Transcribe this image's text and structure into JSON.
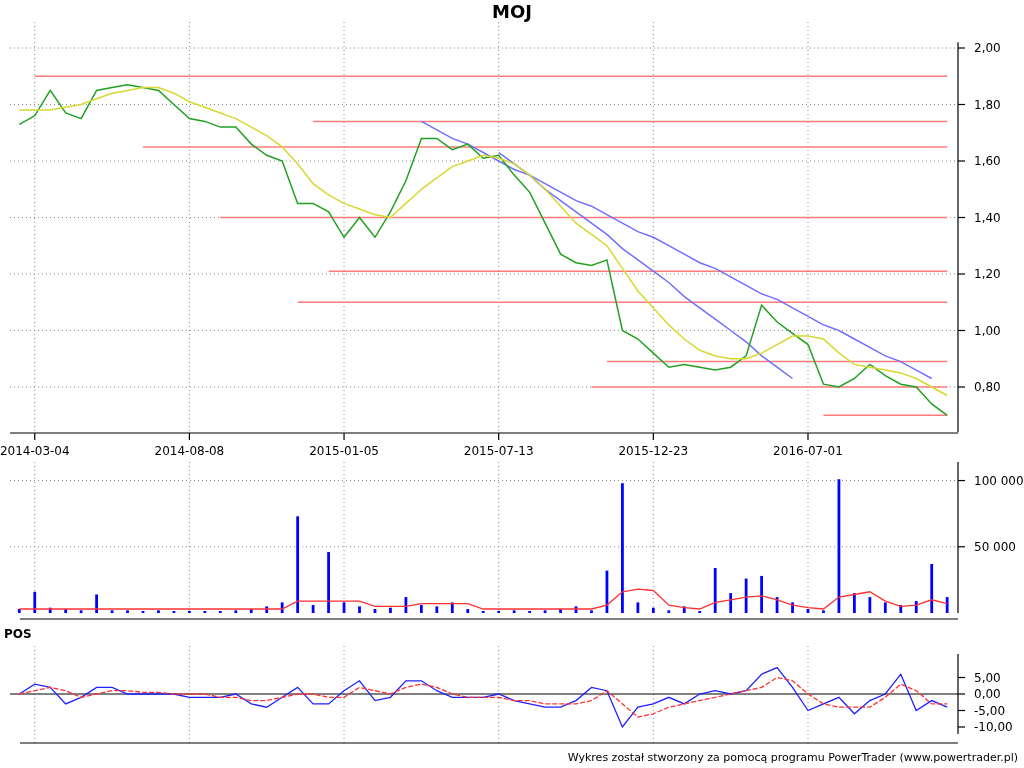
{
  "title": "MOJ",
  "price_panel": {
    "chart_data": {
      "type": "line",
      "categories": [
        null,
        "2014-03-04",
        null,
        null,
        null,
        null,
        null,
        null,
        null,
        null,
        null,
        "2014-08-08",
        null,
        null,
        null,
        null,
        null,
        null,
        null,
        null,
        null,
        "2015-01-05",
        null,
        null,
        null,
        null,
        null,
        null,
        null,
        null,
        null,
        "2015-07-13",
        null,
        null,
        null,
        null,
        null,
        null,
        null,
        null,
        null,
        "2015-12-23",
        null,
        null,
        null,
        null,
        null,
        null,
        null,
        null,
        null,
        "2016-07-01",
        null,
        null,
        null,
        null,
        null,
        null,
        null,
        null,
        null
      ],
      "series": [
        {
          "color": "#ff7b7b",
          "values": [
            null,
            1.9,
            1.9,
            1.9,
            1.9,
            1.9,
            1.9,
            1.9,
            1.9,
            1.9,
            1.9,
            1.9,
            1.9,
            1.9,
            1.9,
            1.9,
            1.9,
            1.9,
            1.9,
            1.9,
            1.9,
            1.9,
            1.9,
            1.9,
            1.9,
            1.9,
            1.9,
            1.9,
            1.9,
            1.9,
            1.9,
            1.9,
            1.9,
            1.9,
            1.9,
            1.9,
            1.9,
            1.9,
            1.9,
            1.9,
            1.9,
            1.9,
            1.9,
            1.9,
            1.9,
            1.9,
            1.9,
            1.9,
            1.9,
            1.9,
            1.9,
            1.9,
            1.9,
            1.9,
            1.9,
            1.9,
            1.9,
            1.9,
            1.9,
            1.9,
            1.9
          ]
        },
        {
          "color": "#ff7b7b",
          "values": [
            null,
            null,
            null,
            null,
            null,
            null,
            null,
            null,
            null,
            null,
            null,
            null,
            null,
            null,
            null,
            null,
            null,
            null,
            null,
            1.74,
            1.74,
            1.74,
            1.74,
            1.74,
            1.74,
            1.74,
            1.74,
            1.74,
            1.74,
            1.74,
            1.74,
            1.74,
            1.74,
            1.74,
            1.74,
            1.74,
            1.74,
            1.74,
            1.74,
            1.74,
            1.74,
            1.74,
            1.74,
            1.74,
            1.74,
            1.74,
            1.74,
            1.74,
            1.74,
            1.74,
            1.74,
            1.74,
            1.74,
            1.74,
            1.74,
            1.74,
            1.74,
            1.74,
            1.74,
            1.74,
            1.74
          ]
        },
        {
          "color": "#ff7b7b",
          "values": [
            null,
            null,
            null,
            null,
            null,
            null,
            null,
            null,
            1.65,
            1.65,
            1.65,
            1.65,
            1.65,
            1.65,
            1.65,
            1.65,
            1.65,
            1.65,
            1.65,
            1.65,
            1.65,
            1.65,
            1.65,
            1.65,
            1.65,
            1.65,
            1.65,
            1.65,
            1.65,
            1.65,
            1.65,
            1.65,
            1.65,
            1.65,
            1.65,
            1.65,
            1.65,
            1.65,
            1.65,
            1.65,
            1.65,
            1.65,
            1.65,
            1.65,
            1.65,
            1.65,
            1.65,
            1.65,
            1.65,
            1.65,
            1.65,
            1.65,
            1.65,
            1.65,
            1.65,
            1.65,
            1.65,
            1.65,
            1.65,
            1.65,
            1.65
          ]
        },
        {
          "color": "#ff7b7b",
          "values": [
            null,
            null,
            null,
            null,
            null,
            null,
            null,
            null,
            null,
            null,
            null,
            null,
            null,
            1.4,
            1.4,
            1.4,
            1.4,
            1.4,
            1.4,
            1.4,
            1.4,
            1.4,
            1.4,
            1.4,
            1.4,
            1.4,
            1.4,
            1.4,
            1.4,
            1.4,
            1.4,
            1.4,
            1.4,
            1.4,
            1.4,
            1.4,
            1.4,
            1.4,
            1.4,
            1.4,
            1.4,
            1.4,
            1.4,
            1.4,
            1.4,
            1.4,
            1.4,
            1.4,
            1.4,
            1.4,
            1.4,
            1.4,
            1.4,
            1.4,
            1.4,
            1.4,
            1.4,
            1.4,
            1.4,
            1.4,
            1.4
          ]
        },
        {
          "color": "#ff7b7b",
          "values": [
            null,
            null,
            null,
            null,
            null,
            null,
            null,
            null,
            null,
            null,
            null,
            null,
            null,
            null,
            null,
            null,
            null,
            null,
            null,
            null,
            1.21,
            1.21,
            1.21,
            1.21,
            1.21,
            1.21,
            1.21,
            1.21,
            1.21,
            1.21,
            1.21,
            1.21,
            1.21,
            1.21,
            1.21,
            1.21,
            1.21,
            1.21,
            1.21,
            1.21,
            1.21,
            1.21,
            1.21,
            1.21,
            1.21,
            1.21,
            1.21,
            1.21,
            1.21,
            1.21,
            1.21,
            1.21,
            1.21,
            1.21,
            1.21,
            1.21,
            1.21,
            1.21,
            1.21,
            1.21,
            1.21
          ]
        },
        {
          "color": "#ff7b7b",
          "values": [
            null,
            null,
            null,
            null,
            null,
            null,
            null,
            null,
            null,
            null,
            null,
            null,
            null,
            null,
            null,
            null,
            null,
            null,
            1.1,
            1.1,
            1.1,
            1.1,
            1.1,
            1.1,
            1.1,
            1.1,
            1.1,
            1.1,
            1.1,
            1.1,
            1.1,
            1.1,
            1.1,
            1.1,
            1.1,
            1.1,
            1.1,
            1.1,
            1.1,
            1.1,
            1.1,
            1.1,
            1.1,
            1.1,
            1.1,
            1.1,
            1.1,
            1.1,
            1.1,
            1.1,
            1.1,
            1.1,
            1.1,
            1.1,
            1.1,
            1.1,
            1.1,
            1.1,
            1.1,
            1.1,
            1.1
          ]
        },
        {
          "color": "#ff7b7b",
          "values": [
            null,
            null,
            null,
            null,
            null,
            null,
            null,
            null,
            null,
            null,
            null,
            null,
            null,
            null,
            null,
            null,
            null,
            null,
            null,
            null,
            null,
            null,
            null,
            null,
            null,
            null,
            null,
            null,
            null,
            null,
            null,
            null,
            null,
            null,
            null,
            null,
            null,
            null,
            0.89,
            0.89,
            0.89,
            0.89,
            0.89,
            0.89,
            0.89,
            0.89,
            0.89,
            0.89,
            0.89,
            0.89,
            0.89,
            0.89,
            0.89,
            0.89,
            0.89,
            0.89,
            0.89,
            0.89,
            0.89,
            0.89,
            0.89
          ]
        },
        {
          "color": "#ff7b7b",
          "values": [
            null,
            null,
            null,
            null,
            null,
            null,
            null,
            null,
            null,
            null,
            null,
            null,
            null,
            null,
            null,
            null,
            null,
            null,
            null,
            null,
            null,
            null,
            null,
            null,
            null,
            null,
            null,
            null,
            null,
            null,
            null,
            null,
            null,
            null,
            null,
            null,
            null,
            0.8,
            0.8,
            0.8,
            0.8,
            0.8,
            0.8,
            0.8,
            0.8,
            0.8,
            0.8,
            0.8,
            0.8,
            0.8,
            0.8,
            0.8,
            0.8,
            0.8,
            0.8,
            0.8,
            0.8,
            0.8,
            0.8,
            0.8,
            0.8
          ]
        },
        {
          "color": "#ff7b7b",
          "values": [
            null,
            null,
            null,
            null,
            null,
            null,
            null,
            null,
            null,
            null,
            null,
            null,
            null,
            null,
            null,
            null,
            null,
            null,
            null,
            null,
            null,
            null,
            null,
            null,
            null,
            null,
            null,
            null,
            null,
            null,
            null,
            null,
            null,
            null,
            null,
            null,
            null,
            null,
            null,
            null,
            null,
            null,
            null,
            null,
            null,
            null,
            null,
            null,
            null,
            null,
            null,
            null,
            0.7,
            0.7,
            0.7,
            0.7,
            0.7,
            0.7,
            0.7,
            0.7,
            0.7
          ]
        },
        {
          "color": "#6f6fff",
          "values": [
            null,
            null,
            null,
            null,
            null,
            null,
            null,
            null,
            null,
            null,
            null,
            null,
            null,
            null,
            null,
            null,
            null,
            null,
            null,
            null,
            null,
            null,
            null,
            null,
            null,
            null,
            1.74,
            1.71,
            1.68,
            1.66,
            1.63,
            1.6,
            1.57,
            1.55,
            1.52,
            1.49,
            1.46,
            1.44,
            1.41,
            1.38,
            1.35,
            1.33,
            1.3,
            1.27,
            1.24,
            1.22,
            1.19,
            1.16,
            1.13,
            1.11,
            1.08,
            1.05,
            1.02,
            1.0,
            0.97,
            0.94,
            0.91,
            0.89,
            0.86,
            0.83,
            null
          ]
        },
        {
          "color": "#6f6fff",
          "values": [
            null,
            null,
            null,
            null,
            null,
            null,
            null,
            null,
            null,
            null,
            null,
            null,
            null,
            null,
            null,
            null,
            null,
            null,
            null,
            null,
            null,
            null,
            null,
            null,
            null,
            null,
            null,
            null,
            null,
            null,
            null,
            1.63,
            1.59,
            1.55,
            1.5,
            1.46,
            1.42,
            1.38,
            1.34,
            1.29,
            1.25,
            1.21,
            1.17,
            1.12,
            1.08,
            1.04,
            1.0,
            0.96,
            0.91,
            0.87,
            0.83,
            null,
            null,
            null,
            null,
            null,
            null,
            null,
            null,
            null,
            null
          ]
        },
        {
          "color": "#22a022",
          "values": [
            1.73,
            1.76,
            1.85,
            1.77,
            1.75,
            1.85,
            1.86,
            1.87,
            1.86,
            1.85,
            1.8,
            1.75,
            1.74,
            1.72,
            1.72,
            1.66,
            1.62,
            1.6,
            1.45,
            1.45,
            1.42,
            1.33,
            1.4,
            1.33,
            1.42,
            1.53,
            1.68,
            1.68,
            1.64,
            1.66,
            1.61,
            1.62,
            1.55,
            1.49,
            1.38,
            1.27,
            1.24,
            1.23,
            1.25,
            1.0,
            0.97,
            0.92,
            0.87,
            0.88,
            0.87,
            0.86,
            0.87,
            0.91,
            1.09,
            1.03,
            0.99,
            0.95,
            0.81,
            0.8,
            0.83,
            0.88,
            0.84,
            0.81,
            0.8,
            0.74,
            0.7
          ]
        },
        {
          "color": "#d8d830",
          "values": [
            1.78,
            1.78,
            1.78,
            1.79,
            1.8,
            1.82,
            1.84,
            1.85,
            1.86,
            1.86,
            1.84,
            1.81,
            1.79,
            1.77,
            1.75,
            1.72,
            1.69,
            1.65,
            1.59,
            1.52,
            1.48,
            1.45,
            1.43,
            1.41,
            1.4,
            1.45,
            1.5,
            1.54,
            1.58,
            1.6,
            1.62,
            1.61,
            1.59,
            1.55,
            1.5,
            1.44,
            1.38,
            1.34,
            1.3,
            1.22,
            1.14,
            1.08,
            1.02,
            0.97,
            0.93,
            0.91,
            0.9,
            0.9,
            0.92,
            0.95,
            0.98,
            0.98,
            0.97,
            0.92,
            0.88,
            0.87,
            0.86,
            0.85,
            0.83,
            0.8,
            0.77
          ]
        }
      ],
      "ylim": [
        0.64,
        2.02
      ],
      "grid": true,
      "yticks": [
        {
          "value": 2.0,
          "label": "2,00"
        },
        {
          "value": 1.8,
          "label": "1,80"
        },
        {
          "value": 1.6,
          "label": "1,60"
        },
        {
          "value": 1.4,
          "label": "1,40"
        },
        {
          "value": 1.2,
          "label": "1,20"
        },
        {
          "value": 1.0,
          "label": "1,00"
        },
        {
          "value": 0.8,
          "label": "0,80"
        }
      ]
    }
  },
  "volume_panel": {
    "chart_data": {
      "type": "bar",
      "categories": [
        null,
        null,
        null,
        null,
        null,
        null,
        null,
        null,
        null,
        null,
        null,
        null,
        null,
        null,
        null,
        null,
        null,
        null,
        null,
        null,
        null,
        null,
        null,
        null,
        null,
        null,
        null,
        null,
        null,
        null,
        null,
        null,
        null,
        null,
        null,
        null,
        null,
        null,
        null,
        null,
        null,
        null,
        null,
        null,
        null,
        null,
        null,
        null,
        null,
        null,
        null,
        null,
        null,
        null,
        null,
        null,
        null,
        null,
        null,
        null,
        null
      ],
      "series": [
        {
          "color": "#0000ff",
          "values": [
            3000,
            16000,
            4000,
            3000,
            2000,
            14000,
            2000,
            2000,
            1500,
            2000,
            1500,
            1500,
            1500,
            1500,
            2000,
            3000,
            5000,
            8000,
            73000,
            6000,
            46000,
            8000,
            5000,
            3000,
            4000,
            12000,
            6000,
            5000,
            8000,
            3000,
            1500,
            1500,
            2000,
            1500,
            2000,
            3000,
            5000,
            2000,
            32000,
            98000,
            8000,
            4000,
            2000,
            5000,
            1500,
            34000,
            15000,
            26000,
            28000,
            12000,
            8000,
            3000,
            2000,
            101000,
            15000,
            12000,
            8000,
            6000,
            9000,
            37000,
            12000
          ]
        },
        {
          "type": "line",
          "color": "#ff3030",
          "values": [
            3000,
            3000,
            3000,
            3000,
            3000,
            3000,
            3000,
            3000,
            3000,
            3000,
            3000,
            3000,
            3000,
            3000,
            3000,
            3000,
            3000,
            3000,
            9000,
            9000,
            9000,
            9000,
            9000,
            5000,
            5000,
            5000,
            7000,
            7000,
            7000,
            7000,
            3000,
            3000,
            3000,
            3000,
            3000,
            3000,
            3000,
            3000,
            6000,
            16000,
            18000,
            17000,
            6000,
            4000,
            3000,
            8000,
            10000,
            12000,
            13000,
            10000,
            6000,
            4000,
            3000,
            12000,
            14000,
            16000,
            9000,
            5000,
            6000,
            10000,
            7000
          ]
        }
      ],
      "ylim": [
        0,
        114000
      ],
      "grid": true,
      "yticks": [
        {
          "value": 100000,
          "label": "100 000"
        },
        {
          "value": 50000,
          "label": "50 000"
        }
      ]
    }
  },
  "pos_panel": {
    "label": "POS",
    "chart_data": {
      "type": "line",
      "categories": [
        null,
        null,
        null,
        null,
        null,
        null,
        null,
        null,
        null,
        null,
        null,
        null,
        null,
        null,
        null,
        null,
        null,
        null,
        null,
        null,
        null,
        null,
        null,
        null,
        null,
        null,
        null,
        null,
        null,
        null,
        null,
        null,
        null,
        null,
        null,
        null,
        null,
        null,
        null,
        null,
        null,
        null,
        null,
        null,
        null,
        null,
        null,
        null,
        null,
        null,
        null,
        null,
        null,
        null,
        null,
        null,
        null,
        null,
        null,
        null,
        null
      ],
      "series": [
        {
          "color": "#2020ff",
          "values": [
            0,
            3,
            2,
            -3,
            -1,
            2,
            2,
            0,
            0,
            0,
            0,
            -1,
            -1,
            -1,
            0,
            -3,
            -4,
            -1,
            2,
            -3,
            -3,
            1,
            4,
            -2,
            -1,
            4,
            4,
            1,
            -1,
            -1,
            -1,
            0,
            -2,
            -3,
            -4,
            -4,
            -2,
            2,
            1,
            -10,
            -4,
            -3,
            -1,
            -3,
            0,
            1,
            0,
            1,
            6,
            8,
            2,
            -5,
            -3,
            -1,
            -6,
            -2,
            0,
            6,
            -5,
            -2,
            -4
          ]
        },
        {
          "color": "#ff3030",
          "line_style": "dashed",
          "values": [
            0,
            1,
            2,
            1,
            -1,
            0,
            1,
            1,
            0.5,
            0.5,
            0,
            0,
            0,
            -1,
            -1,
            -2,
            -2,
            -1,
            0,
            0,
            -1,
            -1,
            2,
            1,
            0,
            2,
            3,
            2,
            0,
            -1,
            -1,
            -1,
            -2,
            -2,
            -3,
            -3,
            -3,
            -2,
            1,
            -3,
            -7,
            -6,
            -4,
            -3,
            -2,
            -1,
            0,
            1,
            2,
            5,
            4,
            0,
            -3,
            -4,
            -4,
            -4,
            -1,
            3,
            1,
            -3,
            -3
          ]
        }
      ],
      "ylim": [
        -15,
        15
      ],
      "grid": true,
      "yticks": [
        {
          "value": 5,
          "label": "5,00"
        },
        {
          "value": 0,
          "label": "0,00"
        },
        {
          "value": -5,
          "label": "-5,00"
        },
        {
          "value": -10,
          "label": "-10,00"
        }
      ]
    }
  },
  "footer": "Wykres został stworzony za pomocą programu PowerTrader (www.powertrader.pl)"
}
